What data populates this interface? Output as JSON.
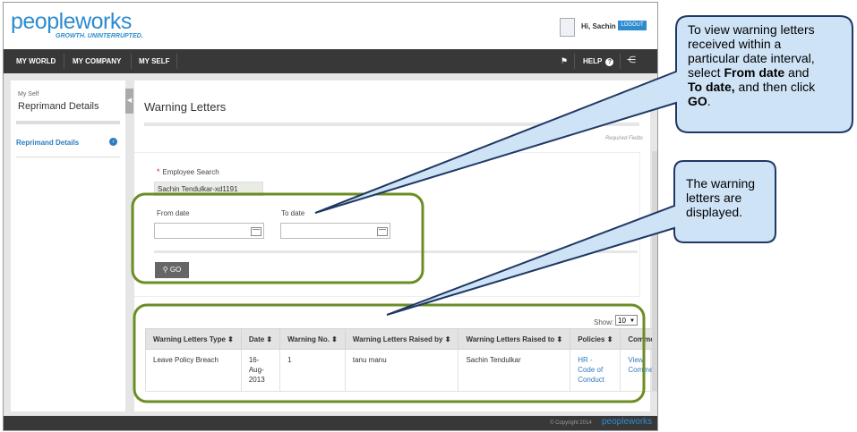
{
  "header": {
    "logo_text": "peopleworks",
    "tagline": "GROWTH. UNINTERRUPTED.",
    "greeting": "Hi, Sachin",
    "logout_label": "LOGOUT"
  },
  "nav": {
    "items": [
      {
        "label": "MY WORLD"
      },
      {
        "label": "MY COMPANY"
      },
      {
        "label": "MY SELF"
      }
    ],
    "help_label": "HELP",
    "icons": [
      "flag-icon",
      "help-icon",
      "sitemap-icon"
    ]
  },
  "sidebar": {
    "section": "My Self",
    "title": "Reprimand Details",
    "link_label": "Reprimand Details"
  },
  "content": {
    "page_title": "Warning Letters",
    "required_note": "Required Fields",
    "employee_search_label": "Employee Search",
    "employee_value": "Sachin Tendulkar-xd1191",
    "from_date_label": "From date",
    "to_date_label": "To date",
    "from_date_value": "",
    "to_date_value": "",
    "go_label": "GO"
  },
  "results": {
    "show_label": "Show:",
    "show_value": "10",
    "columns": [
      "Warning Letters Type",
      "Date",
      "Warning No.",
      "Warning Letters Raised by",
      "Warning Letters Raised to",
      "Policies",
      "Comments"
    ],
    "rows": [
      {
        "type": "Leave Policy Breach",
        "date_lines": [
          "16-",
          "Aug-",
          "2013"
        ],
        "warning_no": "1",
        "raised_by": "tanu manu",
        "raised_to": "Sachin Tendulkar",
        "policy_lines": [
          "HR -",
          "Code of",
          "Conduct"
        ],
        "comments_lines": [
          "View",
          "Comments"
        ]
      }
    ]
  },
  "footer": {
    "copyright": "© Copyright 2014",
    "logo_text": "peopleworks"
  },
  "callouts": {
    "date_callout": {
      "line1": "To view warning letters",
      "line2": "received within a",
      "line3": "particular date interval,",
      "line4_pre": "select ",
      "line4_bold": "From date",
      "line4_post": " and",
      "line5_bold": "To date,",
      "line5_post": " and then click",
      "line6_bold": "GO",
      "line6_post": "."
    },
    "list_callout": {
      "line1": "The warning",
      "line2": "letters are",
      "line3": "displayed."
    }
  },
  "colors": {
    "brand": "#2d8ccf",
    "nav_bg": "#383838",
    "callout_fill": "#cfe3f6",
    "callout_border": "#1f3864",
    "highlight_border": "#6b8e23"
  }
}
